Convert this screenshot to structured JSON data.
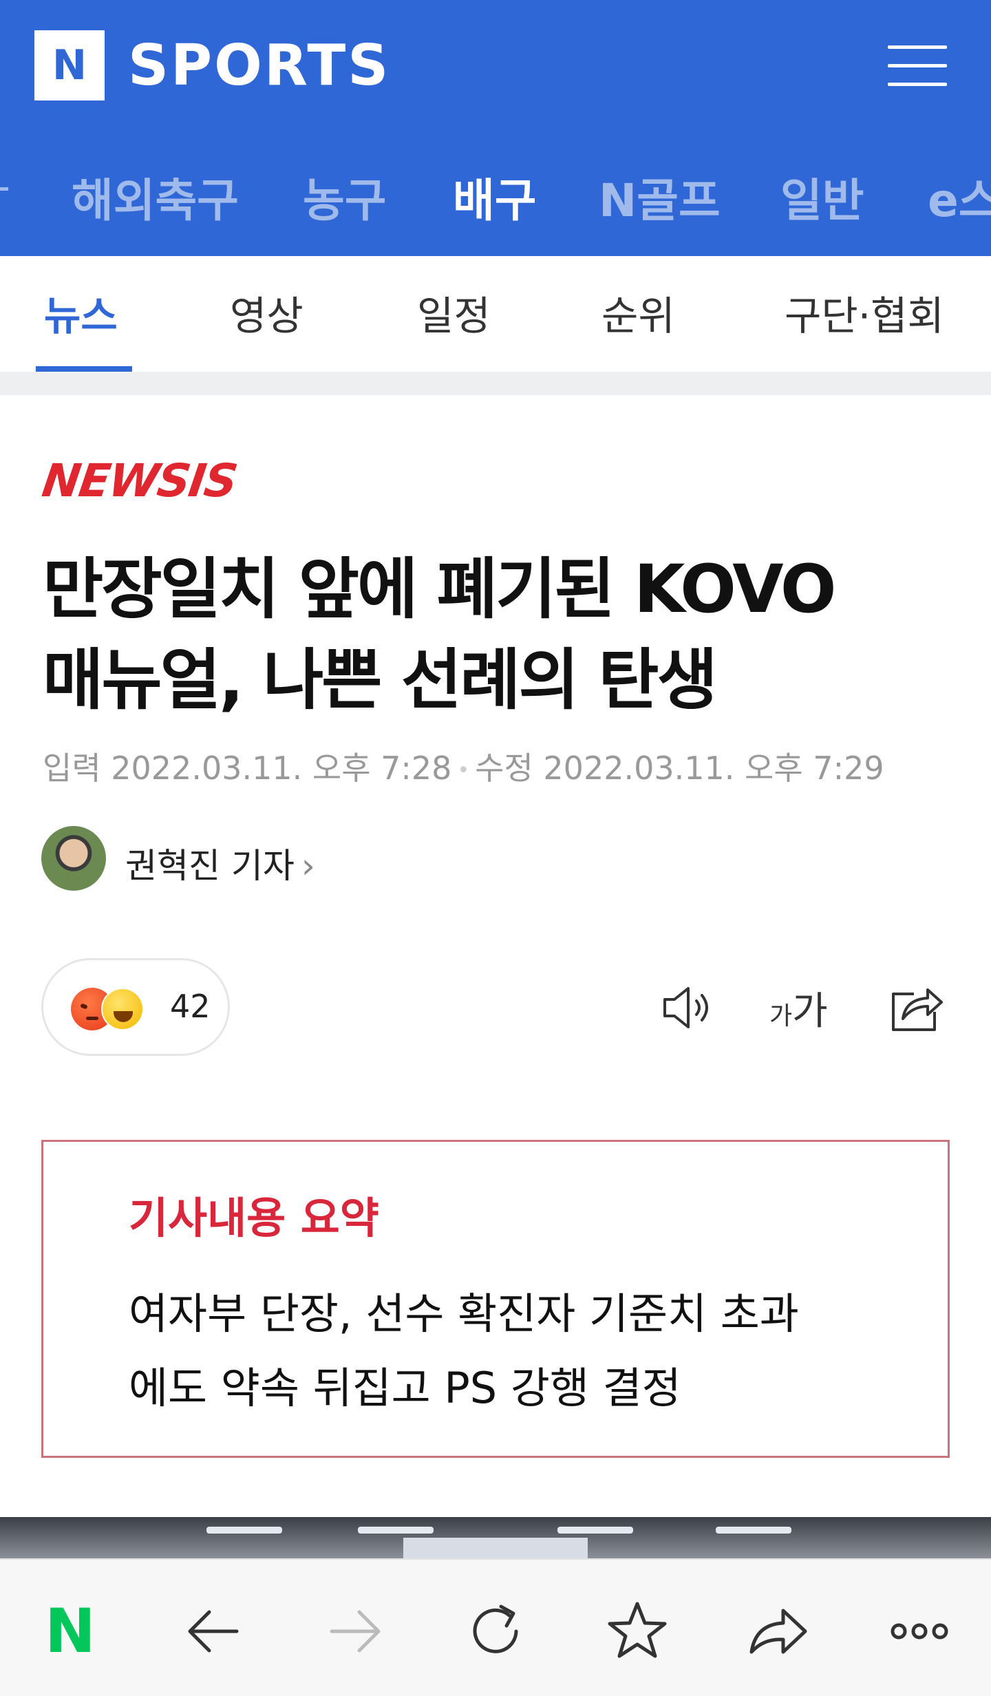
{
  "app": {
    "logo_letter": "N",
    "logo_text": "SPORTS",
    "brand_color": "#2f67d6"
  },
  "categories": [
    {
      "label": "해외축구",
      "active": false
    },
    {
      "label": "농구",
      "active": false
    },
    {
      "label": "배구",
      "active": true
    },
    {
      "label": "N골프",
      "active": false
    },
    {
      "label": "일반",
      "active": false
    },
    {
      "label": "e스",
      "active": false
    }
  ],
  "subtabs": [
    {
      "label": "뉴스",
      "active": true
    },
    {
      "label": "영상",
      "active": false
    },
    {
      "label": "일정",
      "active": false
    },
    {
      "label": "순위",
      "active": false
    },
    {
      "label": "구단·협회",
      "active": false
    }
  ],
  "article": {
    "press": "NEWSIS",
    "headline_line1": "만장일치 앞에 폐기된 KOVO",
    "headline_line2": "매뉴얼, 나쁜 선례의 탄생",
    "published": "입력 2022.03.11. 오후 7:28",
    "modified": "수정 2022.03.11. 오후 7:29",
    "reporter": "권혁진 기자",
    "reporter_chevron": "›",
    "reaction_count": "42",
    "fontsize_small": "가",
    "fontsize_big": "가"
  },
  "summary": {
    "title": "기사내용 요약",
    "line1": "여자부 단장, 선수 확진자 기준치 초과",
    "line2": "에도 약속 뒤집고 PS 강행 결정"
  },
  "icons": {
    "speaker": "speaker-icon",
    "font_size": "font-size-icon",
    "share": "share-icon",
    "back": "back-arrow-icon",
    "forward": "forward-arrow-icon",
    "refresh": "refresh-icon",
    "bookmark": "star-icon",
    "share_page": "share-arrow-icon",
    "more": "more-icon"
  },
  "bottom_nav": {
    "home_letter": "N",
    "home_color": "#03c75a"
  }
}
